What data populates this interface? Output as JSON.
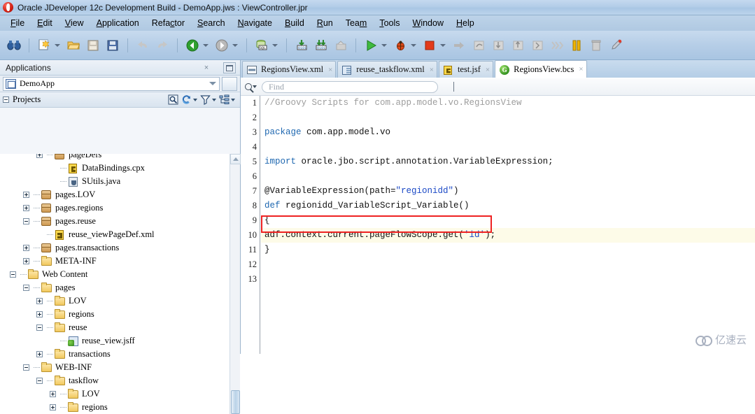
{
  "window": {
    "title": "Oracle JDeveloper 12c Development Build - DemoApp.jws : ViewController.jpr",
    "app_icon": "oracle-logo-icon"
  },
  "menubar": {
    "items": [
      {
        "label": "File",
        "mnemonic": "F"
      },
      {
        "label": "Edit",
        "mnemonic": "E"
      },
      {
        "label": "View",
        "mnemonic": "V"
      },
      {
        "label": "Application",
        "mnemonic": "A"
      },
      {
        "label": "Refactor",
        "mnemonic": "c"
      },
      {
        "label": "Search",
        "mnemonic": "S"
      },
      {
        "label": "Navigate",
        "mnemonic": "N"
      },
      {
        "label": "Build",
        "mnemonic": "B"
      },
      {
        "label": "Run",
        "mnemonic": "R"
      },
      {
        "label": "Team",
        "mnemonic": "m"
      },
      {
        "label": "Tools",
        "mnemonic": "T"
      },
      {
        "label": "Window",
        "mnemonic": "W"
      },
      {
        "label": "Help",
        "mnemonic": "H"
      }
    ]
  },
  "toolbar": {
    "buttons": [
      {
        "name": "search-binoculars-icon",
        "has_dropdown": false
      },
      {
        "name": "new-file-icon",
        "has_dropdown": true
      },
      {
        "name": "open-folder-icon",
        "has_dropdown": false
      },
      {
        "name": "save-icon",
        "has_dropdown": false
      },
      {
        "name": "save-all-icon",
        "has_dropdown": false
      },
      {
        "name": "undo-icon",
        "has_dropdown": false
      },
      {
        "name": "redo-icon",
        "has_dropdown": false
      },
      {
        "name": "navigate-back-icon",
        "has_dropdown": true
      },
      {
        "name": "navigate-forward-icon",
        "has_dropdown": true
      },
      {
        "name": "sql-worksheet-icon",
        "has_dropdown": true
      },
      {
        "name": "make-icon",
        "has_dropdown": false
      },
      {
        "name": "rebuild-icon",
        "has_dropdown": false
      },
      {
        "name": "build-all-icon",
        "has_dropdown": false
      },
      {
        "name": "run-icon",
        "has_dropdown": true
      },
      {
        "name": "debug-icon",
        "has_dropdown": true
      },
      {
        "name": "stop-icon",
        "has_dropdown": true
      },
      {
        "name": "resume-icon",
        "has_dropdown": false
      },
      {
        "name": "step-over-icon",
        "has_dropdown": false
      },
      {
        "name": "step-into-icon",
        "has_dropdown": false
      },
      {
        "name": "step-out-icon",
        "has_dropdown": false
      },
      {
        "name": "step-to-end-icon",
        "has_dropdown": false
      },
      {
        "name": "run-to-cursor-icon",
        "has_dropdown": false
      },
      {
        "name": "pause-icon",
        "has_dropdown": false
      },
      {
        "name": "delete-icon",
        "has_dropdown": false
      },
      {
        "name": "profiler-icon",
        "has_dropdown": false
      }
    ]
  },
  "applications_panel": {
    "title": "Applications",
    "close_label": "×",
    "minimize_icon": "minimize-icon",
    "application_combo": {
      "value": "DemoApp",
      "icon": "application-icon",
      "dropdown_icon": "chevron-down-icon"
    },
    "menu_button_icon": "panel-menu-icon",
    "projects": {
      "label": "Projects",
      "tools": [
        {
          "name": "search-projects-icon"
        },
        {
          "name": "refresh-icon",
          "has_dropdown": true
        },
        {
          "name": "filter-icon",
          "has_dropdown": true
        },
        {
          "name": "show-hierarchy-icon",
          "has_dropdown": true
        }
      ]
    },
    "tree": [
      {
        "label": "pageDefs",
        "indent": 2,
        "toggle": "plus",
        "icon": "package-icon",
        "clipped": true
      },
      {
        "label": "DataBindings.cpx",
        "indent": 3,
        "toggle": "none",
        "icon": "cpx-file-icon"
      },
      {
        "label": "SUtils.java",
        "indent": 3,
        "toggle": "none",
        "icon": "java-file-icon"
      },
      {
        "label": "pages.LOV",
        "indent": 1,
        "toggle": "plus",
        "icon": "package-icon"
      },
      {
        "label": "pages.regions",
        "indent": 1,
        "toggle": "plus",
        "icon": "package-icon"
      },
      {
        "label": "pages.reuse",
        "indent": 1,
        "toggle": "minus",
        "icon": "package-icon"
      },
      {
        "label": "reuse_viewPageDef.xml",
        "indent": 2,
        "toggle": "none",
        "icon": "xml-file-icon"
      },
      {
        "label": "pages.transactions",
        "indent": 1,
        "toggle": "plus",
        "icon": "package-icon"
      },
      {
        "label": "META-INF",
        "indent": 1,
        "toggle": "plus",
        "icon": "folder-icon"
      },
      {
        "label": "Web Content",
        "indent": 0,
        "toggle": "minus",
        "icon": "folder-icon"
      },
      {
        "label": "pages",
        "indent": 1,
        "toggle": "minus",
        "icon": "folder-icon"
      },
      {
        "label": "LOV",
        "indent": 2,
        "toggle": "plus",
        "icon": "folder-icon"
      },
      {
        "label": "regions",
        "indent": 2,
        "toggle": "plus",
        "icon": "folder-icon"
      },
      {
        "label": "reuse",
        "indent": 2,
        "toggle": "minus",
        "icon": "folder-icon"
      },
      {
        "label": "reuse_view.jsff",
        "indent": 3,
        "toggle": "none",
        "icon": "jsff-file-icon"
      },
      {
        "label": "transactions",
        "indent": 2,
        "toggle": "plus",
        "icon": "folder-icon"
      },
      {
        "label": "WEB-INF",
        "indent": 1,
        "toggle": "minus",
        "icon": "folder-icon"
      },
      {
        "label": "taskflow",
        "indent": 2,
        "toggle": "minus",
        "icon": "folder-icon"
      },
      {
        "label": "LOV",
        "indent": 3,
        "toggle": "plus",
        "icon": "folder-icon"
      },
      {
        "label": "regions",
        "indent": 3,
        "toggle": "plus",
        "icon": "folder-icon"
      }
    ],
    "scrollbar": {
      "up_icon": "scroll-up-icon",
      "thumb": "scroll-thumb"
    }
  },
  "editor": {
    "tabs": [
      {
        "label": "RegionsView.xml",
        "icon": "regions-view-icon",
        "active": false,
        "closable": true
      },
      {
        "label": "reuse_taskflow.xml",
        "icon": "taskflow-icon",
        "active": false,
        "closable": true
      },
      {
        "label": "test.jsf",
        "icon": "jsf-icon",
        "active": false,
        "closable": true
      },
      {
        "label": "RegionsView.bcs",
        "icon": "groovy-icon",
        "active": true,
        "closable": true
      }
    ],
    "find": {
      "placeholder": "Find",
      "value": "",
      "icon": "search-icon",
      "dropdown_icon": "chevron-down-icon"
    },
    "code": {
      "line_numbers": [
        "1",
        "2",
        "3",
        "4",
        "5",
        "6",
        "7",
        "8",
        "9",
        "10",
        "11",
        "12",
        "13"
      ],
      "lines": [
        {
          "n": "1",
          "highlight": false,
          "tokens": [
            {
              "t": "//Groovy Scripts for com.app.model.vo.RegionsView",
              "c": "tok-cmt"
            }
          ]
        },
        {
          "n": "2",
          "highlight": false,
          "tokens": []
        },
        {
          "n": "3",
          "highlight": false,
          "tokens": [
            {
              "t": "package",
              "c": "tok-kw"
            },
            {
              "t": " com.app.model.vo",
              "c": ""
            }
          ]
        },
        {
          "n": "4",
          "highlight": false,
          "tokens": []
        },
        {
          "n": "5",
          "highlight": false,
          "tokens": [
            {
              "t": "import",
              "c": "tok-kw"
            },
            {
              "t": " oracle.jbo.script.annotation.VariableExpression;",
              "c": ""
            }
          ]
        },
        {
          "n": "6",
          "highlight": false,
          "tokens": []
        },
        {
          "n": "7",
          "highlight": false,
          "tokens": [
            {
              "t": "@VariableExpression(path=",
              "c": ""
            },
            {
              "t": "\"regionidd\"",
              "c": "tok-str"
            },
            {
              "t": ")",
              "c": ""
            }
          ]
        },
        {
          "n": "8",
          "highlight": false,
          "tokens": [
            {
              "t": "def",
              "c": "tok-kw"
            },
            {
              "t": " regionidd_VariableScript_Variable()",
              "c": ""
            }
          ]
        },
        {
          "n": "9",
          "highlight": false,
          "tokens": [
            {
              "t": "{",
              "c": ""
            }
          ]
        },
        {
          "n": "10",
          "highlight": true,
          "tokens": [
            {
              "t": "adf.context.current.pageFlowScope.get(",
              "c": ""
            },
            {
              "t": "'id'",
              "c": "tok-str"
            },
            {
              "t": ");",
              "c": ""
            }
          ]
        },
        {
          "n": "11",
          "highlight": false,
          "tokens": [
            {
              "t": "}",
              "c": ""
            }
          ]
        },
        {
          "n": "12",
          "highlight": false,
          "tokens": []
        },
        {
          "n": "13",
          "highlight": false,
          "tokens": []
        }
      ]
    },
    "annotation": {
      "name": "red-highlight-box",
      "color": "#ee2222",
      "target_line": "10"
    }
  },
  "watermark": {
    "text": "亿速云",
    "icon": "cloud-icon"
  }
}
